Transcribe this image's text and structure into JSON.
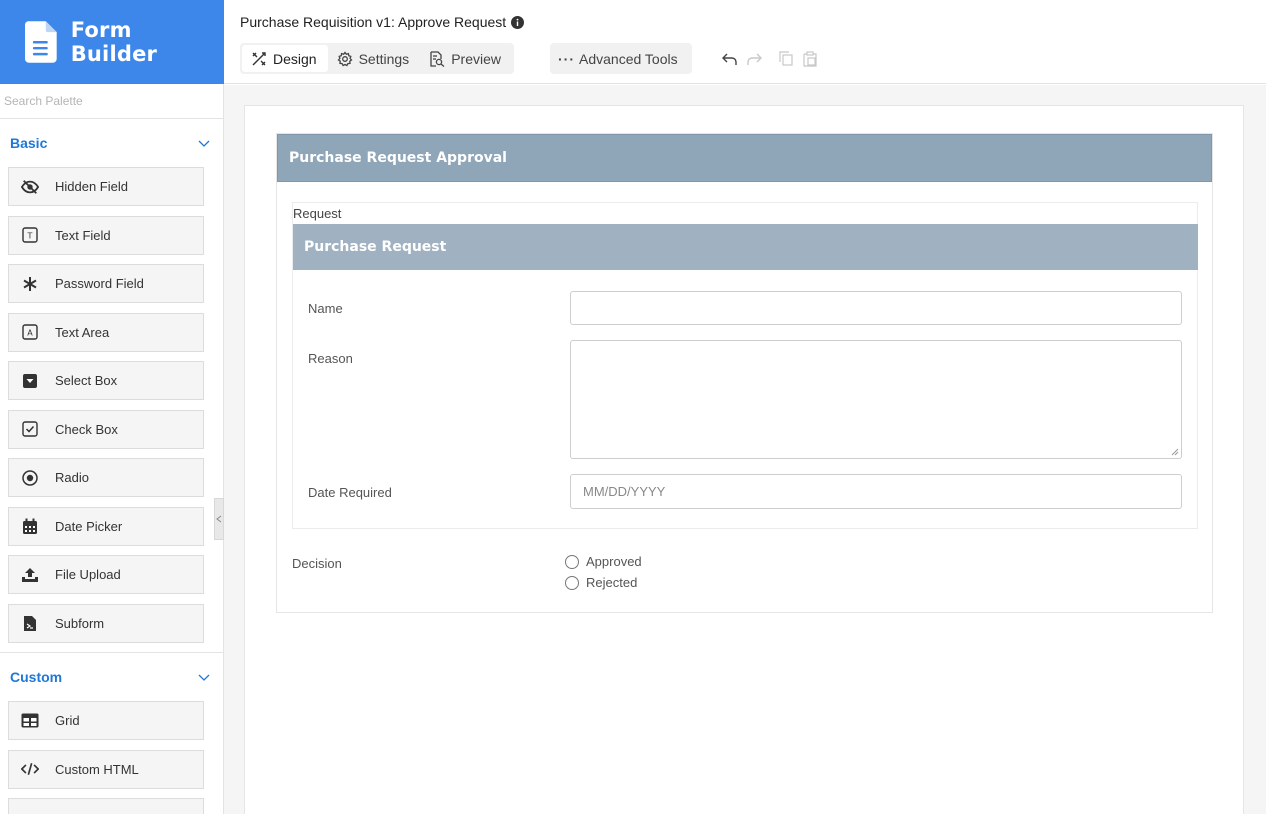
{
  "app": {
    "title": "Form Builder"
  },
  "palette": {
    "search_placeholder": "Search Palette",
    "groups": [
      {
        "title": "Basic",
        "items": [
          {
            "label": "Hidden Field",
            "icon": "eye-slash-icon"
          },
          {
            "label": "Text Field",
            "icon": "text-field-icon"
          },
          {
            "label": "Password Field",
            "icon": "asterisk-icon"
          },
          {
            "label": "Text Area",
            "icon": "text-area-icon"
          },
          {
            "label": "Select Box",
            "icon": "select-box-icon"
          },
          {
            "label": "Check Box",
            "icon": "check-box-icon"
          },
          {
            "label": "Radio",
            "icon": "radio-icon"
          },
          {
            "label": "Date Picker",
            "icon": "calendar-icon"
          },
          {
            "label": "File Upload",
            "icon": "upload-icon"
          },
          {
            "label": "Subform",
            "icon": "subform-icon"
          }
        ]
      },
      {
        "title": "Custom",
        "items": [
          {
            "label": "Grid",
            "icon": "grid-icon"
          },
          {
            "label": "Custom HTML",
            "icon": "code-icon"
          }
        ]
      }
    ]
  },
  "header": {
    "form_title": "Purchase Requisition v1: Approve Request",
    "tabs": [
      {
        "label": "Design",
        "icon": "design-icon",
        "active": true
      },
      {
        "label": "Settings",
        "icon": "gear-icon",
        "active": false
      },
      {
        "label": "Preview",
        "icon": "preview-icon",
        "active": false
      }
    ],
    "advanced_tools_label": "Advanced Tools"
  },
  "form": {
    "panel_title": "Purchase Request Approval",
    "fieldset_legend": "Request",
    "subform_title": "Purchase Request",
    "fields": {
      "name_label": "Name",
      "name_value": "",
      "reason_label": "Reason",
      "reason_value": "",
      "date_label": "Date Required",
      "date_placeholder": "MM/DD/YYYY"
    },
    "decision": {
      "label": "Decision",
      "options": [
        "Approved",
        "Rejected"
      ]
    }
  },
  "colors": {
    "brand": "#3d87ea",
    "group_title": "#1f78d6",
    "panel_header": "#8fa5b8",
    "subform_header": "#a0b2c2"
  }
}
